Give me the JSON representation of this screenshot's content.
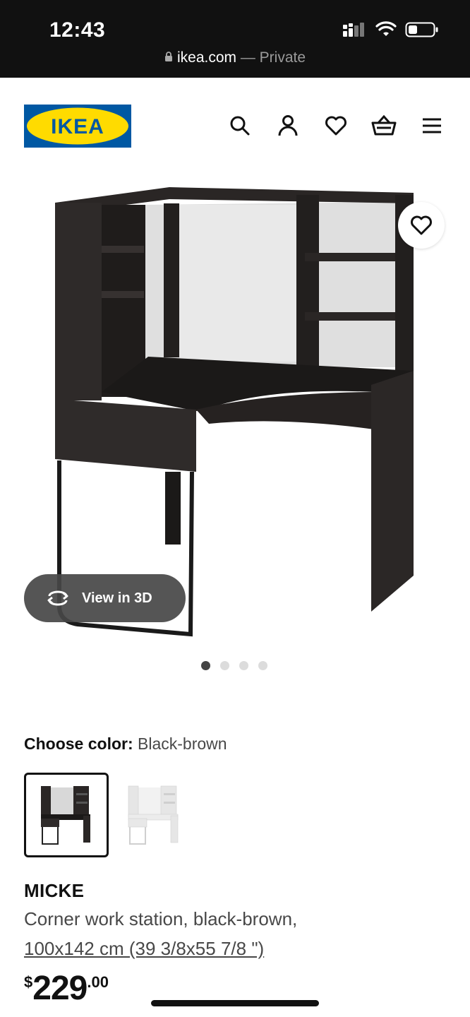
{
  "status_bar": {
    "time": "12:43",
    "url": "ikea.com",
    "separator": " — ",
    "private_label": "Private"
  },
  "header": {
    "logo_text": "IKEA",
    "logo_colors": {
      "blue": "#0058a3",
      "yellow": "#ffdb00"
    },
    "icons": [
      "search-icon",
      "account-icon",
      "heart-icon",
      "basket-icon",
      "menu-icon"
    ]
  },
  "product_gallery": {
    "view_3d_label": "View in 3D",
    "image_count": 4,
    "active_index": 0
  },
  "color_chooser": {
    "label": "Choose color:",
    "selected_value": "Black-brown",
    "options": [
      "Black-brown",
      "White"
    ]
  },
  "product": {
    "name": "MICKE",
    "description": "Corner work station, black-brown,",
    "size": "100x142 cm (39 3/8x55 7/8 \")",
    "price_currency": "$",
    "price_integer": "229",
    "price_decimal": ".00"
  }
}
